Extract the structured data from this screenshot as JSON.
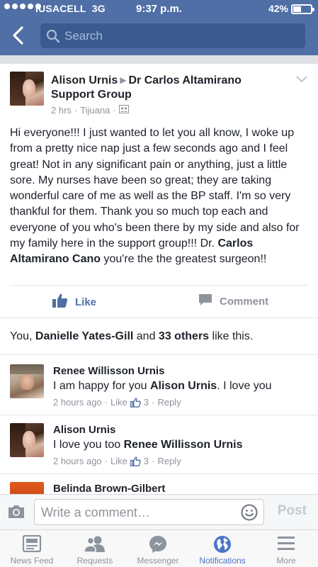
{
  "status_bar": {
    "carrier": "IUSACELL",
    "network": "3G",
    "time": "9:37 p.m.",
    "battery": "42%",
    "battery_level": 0.42
  },
  "header": {
    "search_placeholder": "Search"
  },
  "post": {
    "author": "Alison Urnis",
    "target": "Dr Carlos Altamirano Support Group",
    "time": "2 hrs",
    "location": "Tijuana",
    "body_part1": "Hi everyone!!! I just wanted to let you all know, I woke up from a pretty nice nap just a  few seconds ago and I feel great! Not in any significant pain or anything, just a little sore. My nurses have been so great; they are taking wonderful care of me as well as the BP staff. I'm so very thankful for them. Thank you so much top each and everyone of you who's been there by my side and also for my family here in the support group!!!  Dr. ",
    "body_mention": "Carlos Altamirano Cano",
    "body_part2": " you're the the greatest surgeon!!",
    "like_label": "Like",
    "comment_label": "Comment"
  },
  "likes_summary": {
    "prefix": "You, ",
    "name": "Danielle Yates-Gill",
    "middle": " and ",
    "others": "33 others",
    "suffix": " like this."
  },
  "comments": [
    {
      "author": "Renee Willisson Urnis",
      "text": "I am happy for you ",
      "mention": "Alison Urnis",
      "text_after": ". I love you",
      "time": "2 hours ago",
      "like_label": "Like",
      "likes": "3",
      "reply_label": "Reply"
    },
    {
      "author": "Alison Urnis",
      "text": "I love you too ",
      "mention": "Renee Willisson Urnis",
      "text_after": "",
      "time": "2 hours ago",
      "like_label": "Like",
      "likes": "3",
      "reply_label": "Reply"
    },
    {
      "author": "Belinda Brown-Gilbert"
    }
  ],
  "composer": {
    "placeholder": "Write a comment…",
    "post_label": "Post"
  },
  "tabs": [
    {
      "label": "News Feed",
      "icon": "news-feed-icon"
    },
    {
      "label": "Requests",
      "icon": "friend-requests-icon"
    },
    {
      "label": "Messenger",
      "icon": "messenger-icon"
    },
    {
      "label": "Notifications",
      "icon": "globe-icon",
      "active": true
    },
    {
      "label": "More",
      "icon": "menu-icon"
    }
  ],
  "colors": {
    "brand_blue": "#4f6fa6",
    "active_tab": "#4a76c8",
    "meta_gray": "#90949c"
  }
}
